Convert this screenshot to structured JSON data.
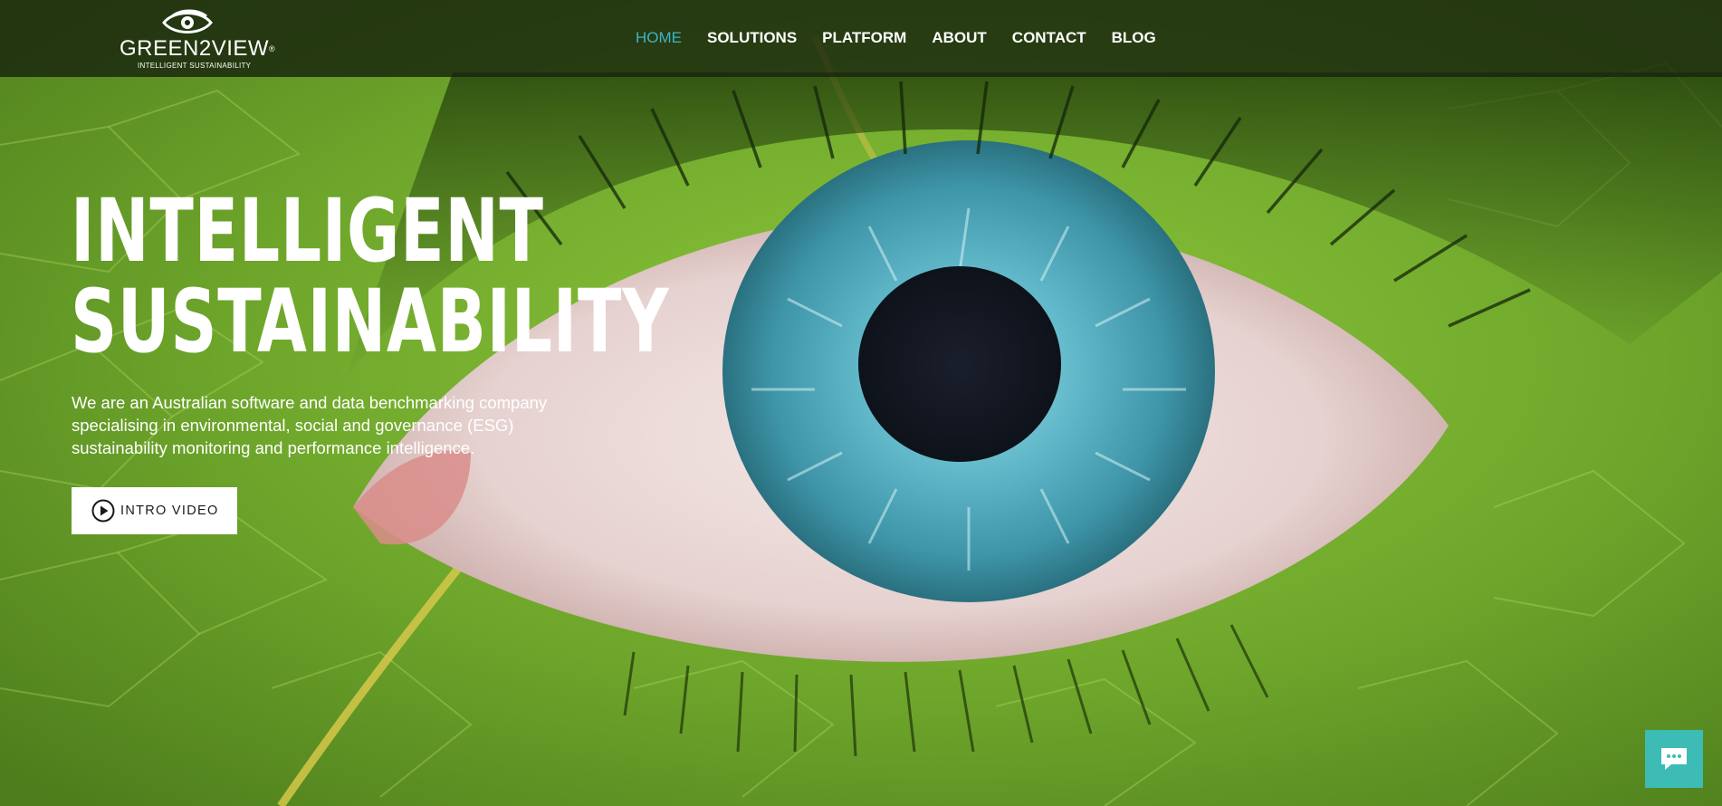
{
  "brand": {
    "name": "GREEN2VIEW",
    "tagline": "INTELLIGENT SUSTAINABILITY",
    "registered_mark": "®"
  },
  "nav": {
    "items": [
      {
        "label": "HOME",
        "active": true
      },
      {
        "label": "SOLUTIONS",
        "active": false
      },
      {
        "label": "PLATFORM",
        "active": false
      },
      {
        "label": "ABOUT",
        "active": false
      },
      {
        "label": "CONTACT",
        "active": false
      },
      {
        "label": "BLOG",
        "active": false
      }
    ]
  },
  "hero": {
    "title_line1": "INTELLIGENT",
    "title_line2": "SUSTAINABILITY",
    "description": "We are an Australian software and data benchmarking company specialising in environmental, social and governance (ESG) sustainability monitoring and performance intelligence.",
    "cta_label": "INTRO VIDEO"
  },
  "icons": {
    "logo": "eye-logo-icon",
    "cta": "play-circle-icon",
    "chat": "chat-bubble-icon"
  },
  "colors": {
    "accent": "#3fb3c4",
    "header_bg": "#18240e",
    "chat_bg": "#3cbcb4",
    "leaf_green": "#6fa52a",
    "iris_blue": "#3e95a8"
  }
}
